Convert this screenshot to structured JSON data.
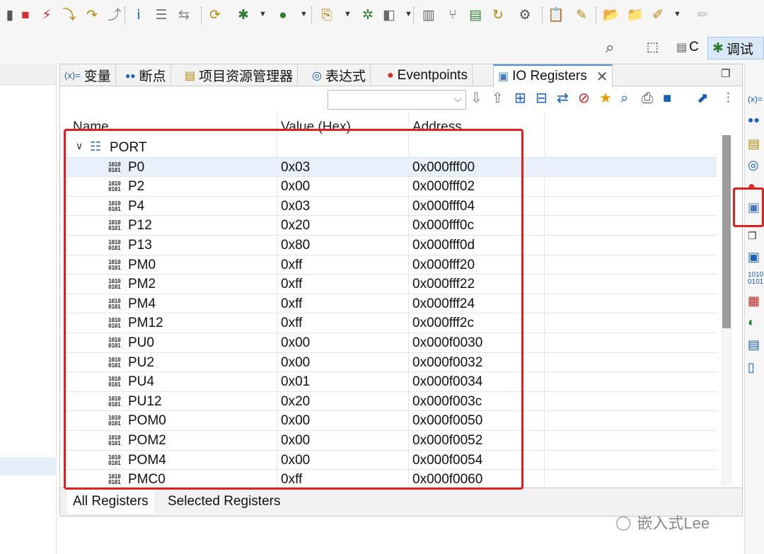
{
  "toolbar": {
    "icons": [
      {
        "name": "step-marker-icon",
        "glyph": "▮",
        "color": "#555"
      },
      {
        "name": "terminate-icon",
        "glyph": "■",
        "color": "#d32f2f"
      },
      {
        "name": "disconnect-icon",
        "glyph": "⚡",
        "color": "#c62828"
      },
      {
        "name": "step-into-icon",
        "glyph": "⤵",
        "color": "#b8860b"
      },
      {
        "name": "step-over-icon",
        "glyph": "↷",
        "color": "#b8860b"
      },
      {
        "name": "step-return-icon",
        "glyph": "⤴",
        "color": "#888"
      },
      {
        "name": "instruction-step-icon",
        "glyph": "ⅰ",
        "color": "#1a5fb4"
      },
      {
        "name": "drop-to-frame-icon",
        "glyph": "☰",
        "color": "#777"
      },
      {
        "name": "use-step-filters-icon",
        "glyph": "⇆",
        "color": "#888"
      },
      {
        "name": "restart-icon",
        "glyph": "⟳",
        "color": "#b8860b"
      },
      {
        "name": "debug-icon",
        "glyph": "✱",
        "color": "#2e7d32"
      },
      {
        "name": "run-icon",
        "glyph": "●",
        "color": "#2e7d32"
      },
      {
        "name": "external-tools-icon",
        "glyph": "⎘",
        "color": "#b8860b"
      },
      {
        "name": "profile-icon",
        "glyph": "✲",
        "color": "#2e7d32"
      },
      {
        "name": "skip-breakpoints-icon",
        "glyph": "◧",
        "color": "#666"
      },
      {
        "name": "columns-icon",
        "glyph": "▥",
        "color": "#666"
      },
      {
        "name": "branch-icon",
        "glyph": "⑂",
        "color": "#666"
      },
      {
        "name": "memory-icon",
        "glyph": "▤",
        "color": "#2e7d32"
      },
      {
        "name": "reload-icon",
        "glyph": "↻",
        "color": "#b8860b"
      },
      {
        "name": "settings-icon",
        "glyph": "⚙",
        "color": "#555"
      },
      {
        "name": "clipboard-icon",
        "glyph": "📋",
        "color": "#555"
      },
      {
        "name": "pen-icon",
        "glyph": "✎",
        "color": "#b8860b"
      },
      {
        "name": "open-folder-icon",
        "glyph": "📂",
        "color": "#b8860b"
      },
      {
        "name": "save-folder-icon",
        "glyph": "📁",
        "color": "#b8860b"
      },
      {
        "name": "brush-icon",
        "glyph": "✐",
        "color": "#b8860b"
      },
      {
        "name": "pencil-disabled-icon",
        "glyph": "✏",
        "color": "#bbb"
      }
    ]
  },
  "perspective": {
    "c_label": "C",
    "debug_label": "调试"
  },
  "tabs": [
    {
      "id": "variables",
      "icon": "(x)=",
      "label": "变量"
    },
    {
      "id": "breakpoints",
      "icon": "●●",
      "label": "断点"
    },
    {
      "id": "project-explorer",
      "icon": "▤",
      "label": "项目资源管理器"
    },
    {
      "id": "expressions",
      "icon": "◎",
      "label": "表达式"
    },
    {
      "id": "eventpoints",
      "icon": "●",
      "label": "Eventpoints"
    },
    {
      "id": "io-registers",
      "icon": "▣",
      "label": "IO Registers",
      "active": true
    }
  ],
  "table": {
    "columns": [
      "Name",
      "Value (Hex)",
      "Address"
    ],
    "group": {
      "label": "PORT",
      "expanded": true
    },
    "rows": [
      {
        "name": "P0",
        "value": "0x03",
        "address": "0x000fff00",
        "selected": true
      },
      {
        "name": "P2",
        "value": "0x00",
        "address": "0x000fff02"
      },
      {
        "name": "P4",
        "value": "0x03",
        "address": "0x000fff04"
      },
      {
        "name": "P12",
        "value": "0x20",
        "address": "0x000fff0c"
      },
      {
        "name": "P13",
        "value": "0x80",
        "address": "0x000fff0d"
      },
      {
        "name": "PM0",
        "value": "0xff",
        "address": "0x000fff20"
      },
      {
        "name": "PM2",
        "value": "0xff",
        "address": "0x000fff22"
      },
      {
        "name": "PM4",
        "value": "0xff",
        "address": "0x000fff24"
      },
      {
        "name": "PM12",
        "value": "0xff",
        "address": "0x000fff2c"
      },
      {
        "name": "PU0",
        "value": "0x00",
        "address": "0x000f0030"
      },
      {
        "name": "PU2",
        "value": "0x00",
        "address": "0x000f0032"
      },
      {
        "name": "PU4",
        "value": "0x01",
        "address": "0x000f0034"
      },
      {
        "name": "PU12",
        "value": "0x20",
        "address": "0x000f003c"
      },
      {
        "name": "POM0",
        "value": "0x00",
        "address": "0x000f0050"
      },
      {
        "name": "POM2",
        "value": "0x00",
        "address": "0x000f0052"
      },
      {
        "name": "POM4",
        "value": "0x00",
        "address": "0x000f0054"
      },
      {
        "name": "PMC0",
        "value": "0xff",
        "address": "0x000f0060"
      }
    ]
  },
  "bottom_tabs": [
    "All Registers",
    "Selected Registers"
  ],
  "watermark": "嵌入式Lee",
  "colors": {
    "highlight": "#e02020",
    "selection": "#e8f1fb",
    "active_perspective": "#d9e8f6"
  }
}
